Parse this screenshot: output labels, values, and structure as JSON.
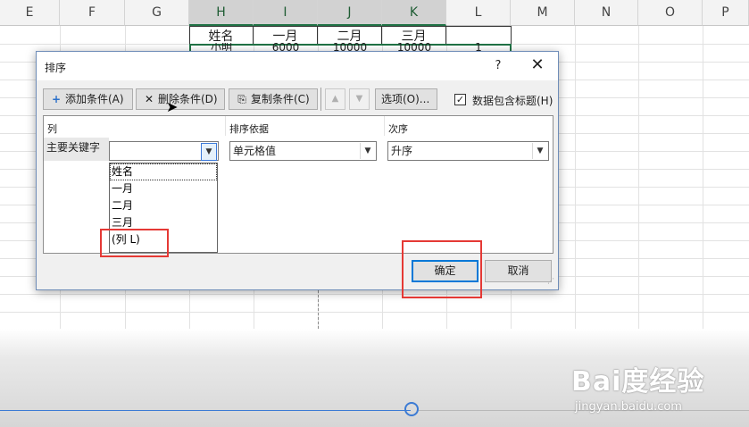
{
  "sheet": {
    "columns": [
      "E",
      "F",
      "G",
      "H",
      "I",
      "J",
      "K",
      "L",
      "M",
      "N",
      "O",
      "P"
    ],
    "selected_columns": [
      "H",
      "I",
      "J",
      "K"
    ],
    "table_headers": [
      "姓名",
      "一月",
      "二月",
      "三月"
    ],
    "row2_partial": [
      "小明",
      "6000",
      "10000",
      "10000",
      "1"
    ]
  },
  "dialog": {
    "title": "排序",
    "help": "?",
    "close": "✕",
    "toolbar": {
      "add_condition": "添加条件(A)",
      "delete_condition": "删除条件(D)",
      "copy_condition": "复制条件(C)",
      "move_up": "▲",
      "move_down": "▼",
      "options": "选项(O)...",
      "has_headers_checked": "✓",
      "has_headers": "数据包含标题(H)"
    },
    "grid": {
      "col_header": "列",
      "sort_on_header": "排序依据",
      "order_header": "次序",
      "row_label": "主要关键字",
      "key_value": "",
      "sort_on_value": "单元格值",
      "order_value": "升序"
    },
    "dropdown_options": [
      "姓名",
      "一月",
      "二月",
      "三月",
      "(列 L)"
    ],
    "ok": "确定",
    "cancel": "取消"
  },
  "watermark": {
    "logo": "Bai度经验",
    "url": "jingyan.baidu.com"
  },
  "colors": {
    "accent": "#0078d7",
    "highlight_box": "#e53935",
    "excel_green": "#217346"
  }
}
